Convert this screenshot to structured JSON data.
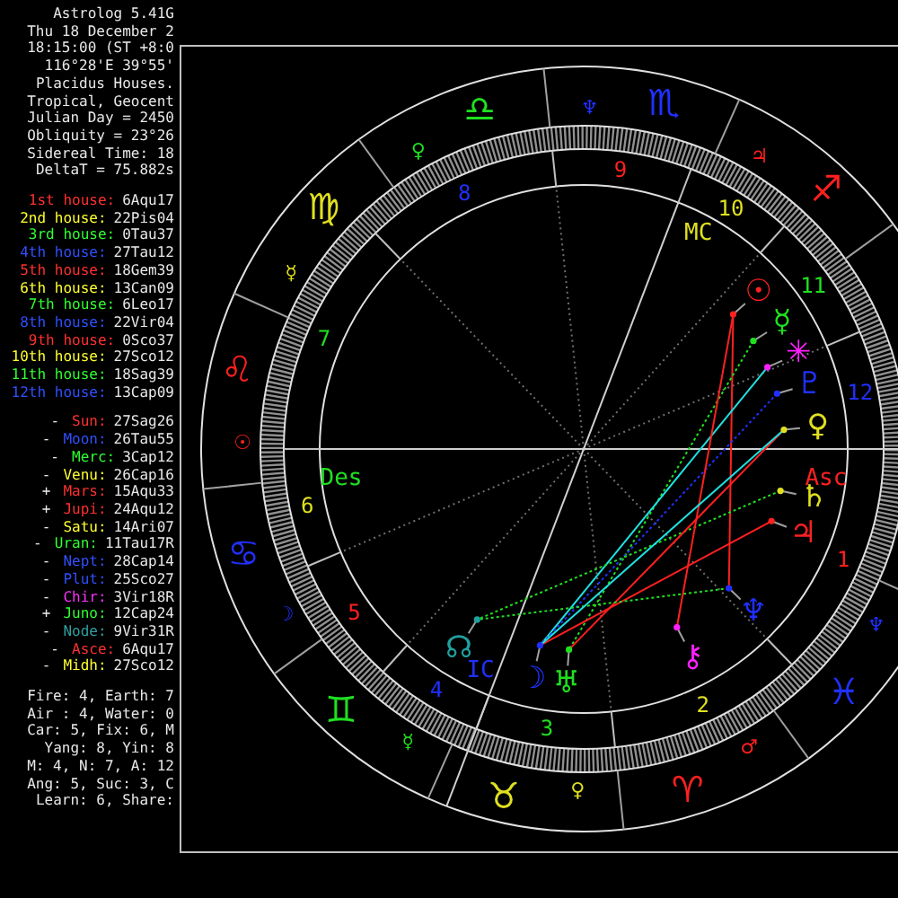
{
  "header": [
    "Astrolog 5.41G",
    "Thu 18 December 2",
    "18:15:00 (ST +8:0",
    "116°28'E 39°55'",
    "Placidus Houses.",
    "Tropical, Geocent",
    "Julian Day = 2450",
    "Obliquity = 23°26",
    "Sidereal Time: 18",
    "DeltaT = 75.882s"
  ],
  "houses": [
    {
      "label": "1st house:",
      "value": "6Aqu17",
      "color": "#ff3030"
    },
    {
      "label": "2nd house:",
      "value": "22Pis04",
      "color": "#ffff30"
    },
    {
      "label": "3rd house:",
      "value": "0Tau37",
      "color": "#30ff30"
    },
    {
      "label": "4th house:",
      "value": "27Tau12",
      "color": "#3050ff"
    },
    {
      "label": "5th house:",
      "value": "18Gem39",
      "color": "#ff3030"
    },
    {
      "label": "6th house:",
      "value": "13Can09",
      "color": "#ffff30"
    },
    {
      "label": "7th house:",
      "value": "6Leo17",
      "color": "#30ff30"
    },
    {
      "label": "8th house:",
      "value": "22Vir04",
      "color": "#3050ff"
    },
    {
      "label": "9th house:",
      "value": "0Sco37",
      "color": "#ff3030"
    },
    {
      "label": "10th house:",
      "value": "27Sco12",
      "color": "#ffff30"
    },
    {
      "label": "11th house:",
      "value": "18Sag39",
      "color": "#30ff30"
    },
    {
      "label": "12th house:",
      "value": "13Cap09",
      "color": "#3050ff"
    }
  ],
  "planets": [
    {
      "name": "Sun:",
      "position": "27Sag26",
      "motion": "-",
      "color": "#ff3030"
    },
    {
      "name": "Moon:",
      "position": "26Tau55",
      "motion": "-",
      "color": "#3050ff"
    },
    {
      "name": "Merc:",
      "position": "3Cap12",
      "motion": "-",
      "color": "#30ff30"
    },
    {
      "name": "Venu:",
      "position": "26Cap16",
      "motion": "-",
      "color": "#ffff30"
    },
    {
      "name": "Mars:",
      "position": "15Aqu33",
      "motion": "+",
      "color": "#ff3030"
    },
    {
      "name": "Jupi:",
      "position": "24Aqu12",
      "motion": "+",
      "color": "#ff3030"
    },
    {
      "name": "Satu:",
      "position": "14Ari07",
      "motion": "-",
      "color": "#ffff30"
    },
    {
      "name": "Uran:",
      "position": "11Tau17R",
      "motion": "-",
      "color": "#30ff30"
    },
    {
      "name": "Nept:",
      "position": "28Cap14",
      "motion": "-",
      "color": "#3050ff"
    },
    {
      "name": "Plut:",
      "position": "25Sco27",
      "motion": "-",
      "color": "#3050ff"
    },
    {
      "name": "Chir:",
      "position": "3Vir18R",
      "motion": "-",
      "color": "#ff30ff"
    },
    {
      "name": "Juno:",
      "position": "12Cap24",
      "motion": "+",
      "color": "#30ff30"
    },
    {
      "name": "Node:",
      "position": "9Vir31R",
      "motion": "-",
      "color": "#30a0a0"
    },
    {
      "name": "Asce:",
      "position": "6Aqu17",
      "motion": "-",
      "color": "#ff3030"
    },
    {
      "name": "Midh:",
      "position": "27Sco12",
      "motion": "-",
      "color": "#ffff30"
    }
  ],
  "summary": [
    "Fire: 4, Earth: 7",
    "Air : 4, Water: 0",
    "Car: 5, Fix: 6, M",
    "Yang: 8, Yin: 8",
    "M: 4, N: 7, A: 12",
    "Ang: 5, Suc: 3, C",
    "Learn: 6, Share:"
  ],
  "chart": {
    "signs": [
      {
        "glyph": "♎",
        "ruler": "♀",
        "color": "#20e020"
      },
      {
        "glyph": "♏",
        "ruler": "♆",
        "color": "#2030ff"
      },
      {
        "glyph": "♐",
        "ruler": "♃",
        "color": "#ff2020"
      },
      {
        "glyph": "♍",
        "ruler": "☿",
        "color": "#e0e020"
      },
      {
        "glyph": "♌",
        "ruler": "☉",
        "color": "#ff2020"
      },
      {
        "glyph": "♋",
        "ruler": "☽",
        "color": "#2030ff"
      },
      {
        "glyph": "♓",
        "ruler": "♆",
        "color": "#2030ff"
      },
      {
        "glyph": "♊",
        "ruler": "☿",
        "color": "#20e020"
      },
      {
        "glyph": "♉",
        "ruler": "♀",
        "color": "#e0e020"
      },
      {
        "glyph": "♈",
        "ruler": "♂",
        "color": "#ff2020"
      }
    ],
    "house_numbers": [
      {
        "text": "1",
        "color": "#ff2020"
      },
      {
        "text": "2",
        "color": "#e0e020"
      },
      {
        "text": "3",
        "color": "#20e020"
      },
      {
        "text": "4",
        "color": "#2030ff"
      },
      {
        "text": "5",
        "color": "#ff2020"
      },
      {
        "text": "6",
        "color": "#e0e020"
      },
      {
        "text": "7",
        "color": "#20e020"
      },
      {
        "text": "8",
        "color": "#2030ff"
      },
      {
        "text": "9",
        "color": "#ff2020"
      },
      {
        "text": "10",
        "color": "#e0e020"
      },
      {
        "text": "11",
        "color": "#20e020"
      },
      {
        "text": "12",
        "color": "#2030ff"
      }
    ],
    "angles": [
      {
        "text": "Asc",
        "color": "#ff2020"
      },
      {
        "text": "MC",
        "color": "#e0e020"
      },
      {
        "text": "Des",
        "color": "#20e020"
      },
      {
        "text": "IC",
        "color": "#2030ff"
      }
    ],
    "planet_glyphs": [
      {
        "glyph": "☉",
        "color": "#ff2020"
      },
      {
        "glyph": "☿",
        "color": "#20e020"
      },
      {
        "glyph": "✳",
        "color": "#ff20ff"
      },
      {
        "glyph": "♇",
        "color": "#2030ff"
      },
      {
        "glyph": "♀",
        "color": "#e0e020"
      },
      {
        "glyph": "♄",
        "color": "#e0e020"
      },
      {
        "glyph": "♃",
        "color": "#ff2020"
      },
      {
        "glyph": "♆",
        "color": "#2030ff"
      },
      {
        "glyph": "⚷",
        "color": "#ff20ff"
      },
      {
        "glyph": "♅",
        "color": "#20e020"
      },
      {
        "glyph": "☽",
        "color": "#2030ff"
      },
      {
        "glyph": "☊",
        "color": "#20a0a0"
      }
    ]
  }
}
